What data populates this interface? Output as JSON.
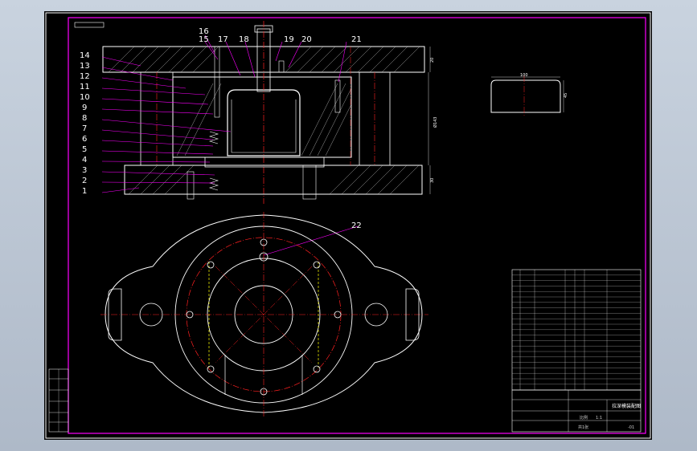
{
  "drawing": {
    "part_labels_left": [
      "14",
      "13",
      "12",
      "11",
      "10",
      "9",
      "8",
      "7",
      "6",
      "5",
      "4",
      "3",
      "2",
      "1"
    ],
    "part_labels_top": [
      "16",
      "15",
      "17",
      "18",
      "19",
      "20",
      "21"
    ],
    "part_label_plan": "22",
    "dimensions": {
      "top_plate": "20",
      "bottom_plate": "30",
      "height": "Ø143",
      "blank_width": "100",
      "blank_height": "45"
    },
    "title_block": {
      "drawing_title": "拉深模装配图",
      "scale": "1:1",
      "total": "共1张",
      "scale_label": "比例",
      "drawing_no": "-01"
    }
  },
  "colors": {
    "sheet": "#000000",
    "frame": "#ff00ff",
    "outline": "#ffffff",
    "centerline": "#ff2020",
    "hidden": "#ffff00",
    "leader": "#ff00ff"
  }
}
